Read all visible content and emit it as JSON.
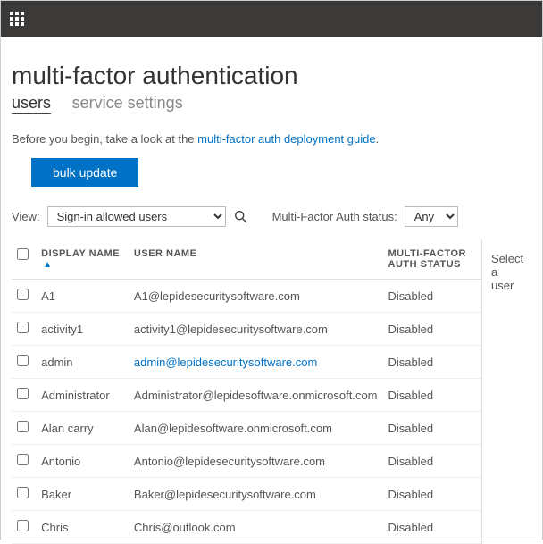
{
  "header": {
    "title": "multi-factor authentication"
  },
  "tabs": {
    "active": "users",
    "inactive": "service settings"
  },
  "intro": {
    "prefix": "Before you begin, take a look at the ",
    "link": "multi-factor auth deployment guide",
    "suffix": "."
  },
  "buttons": {
    "bulk": "bulk update"
  },
  "filters": {
    "view_label": "View:",
    "view_value": "Sign-in allowed users",
    "status_label": "Multi-Factor Auth status:",
    "status_value": "Any"
  },
  "columns": {
    "display_name": "DISPLAY NAME",
    "user_name": "USER NAME",
    "mfa_status": "MULTI-FACTOR AUTH STATUS"
  },
  "side": {
    "select_user": "Select a user"
  },
  "rows": [
    {
      "name": "A1",
      "user": "A1@lepidesecuritysoftware.com",
      "status": "Disabled",
      "link": false
    },
    {
      "name": "activity1",
      "user": "activity1@lepidesecuritysoftware.com",
      "status": "Disabled",
      "link": false
    },
    {
      "name": "admin",
      "user": "admin@lepidesecuritysoftware.com",
      "status": "Disabled",
      "link": true
    },
    {
      "name": "Administrator",
      "user": "Administrator@lepidesoftware.onmicrosoft.com",
      "status": "Disabled",
      "link": false
    },
    {
      "name": "Alan carry",
      "user": "Alan@lepidesoftware.onmicrosoft.com",
      "status": "Disabled",
      "link": false
    },
    {
      "name": "Antonio",
      "user": "Antonio@lepidesecuritysoftware.com",
      "status": "Disabled",
      "link": false
    },
    {
      "name": "Baker",
      "user": "Baker@lepidesecuritysoftware.com",
      "status": "Disabled",
      "link": false
    },
    {
      "name": "Chris",
      "user": "Chris@outlook.com",
      "status": "Disabled",
      "link": false
    }
  ]
}
